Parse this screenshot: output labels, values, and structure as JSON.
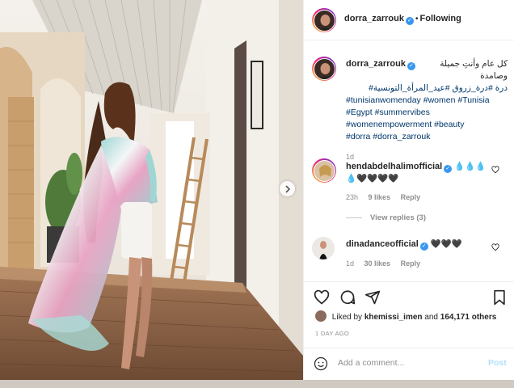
{
  "post": {
    "username": "dorra_zarrouk",
    "follow_status": "Following",
    "caption": {
      "arabic_line1": "كل عام وأنتِ جميلة وصامدة",
      "arabic_line2": "درة #درة_زروق #عيد_المرأة_التونسية#",
      "tag_line3": "#tunisianwomenday #women #Tunisia",
      "tag_line4": "#Egypt #summervibes",
      "tag_line5": "#womenempowerment #beauty",
      "tag_line6": "#dorra #dorra_zarrouk",
      "time": "1d"
    },
    "comments": [
      {
        "username": "hendabdelhalimofficial",
        "text_line1": "💧💧💧",
        "text_line2": "💧🖤🖤🖤🖤",
        "time": "23h",
        "likes": "9 likes",
        "reply": "Reply",
        "view_replies": "View replies (3)"
      },
      {
        "username": "dinadanceofficial",
        "text": "🖤🖤🖤",
        "time": "1d",
        "likes": "30 likes",
        "reply": "Reply"
      }
    ],
    "likes": {
      "prefix": "Liked by",
      "user": "khemissi_imen",
      "middle": "and",
      "count": "164,171 others"
    },
    "date": "1 DAY AGO",
    "add_comment": {
      "placeholder": "Add a comment...",
      "post_label": "Post"
    }
  },
  "colors": {
    "link": "#00376b",
    "verified": "#3897f0",
    "muted": "#8e8e8e",
    "post_disabled": "#b2dffc"
  },
  "icons": [
    "verified-icon",
    "heart-icon",
    "comment-icon",
    "share-icon",
    "bookmark-icon",
    "emoji-icon",
    "chevron-right-icon"
  ]
}
